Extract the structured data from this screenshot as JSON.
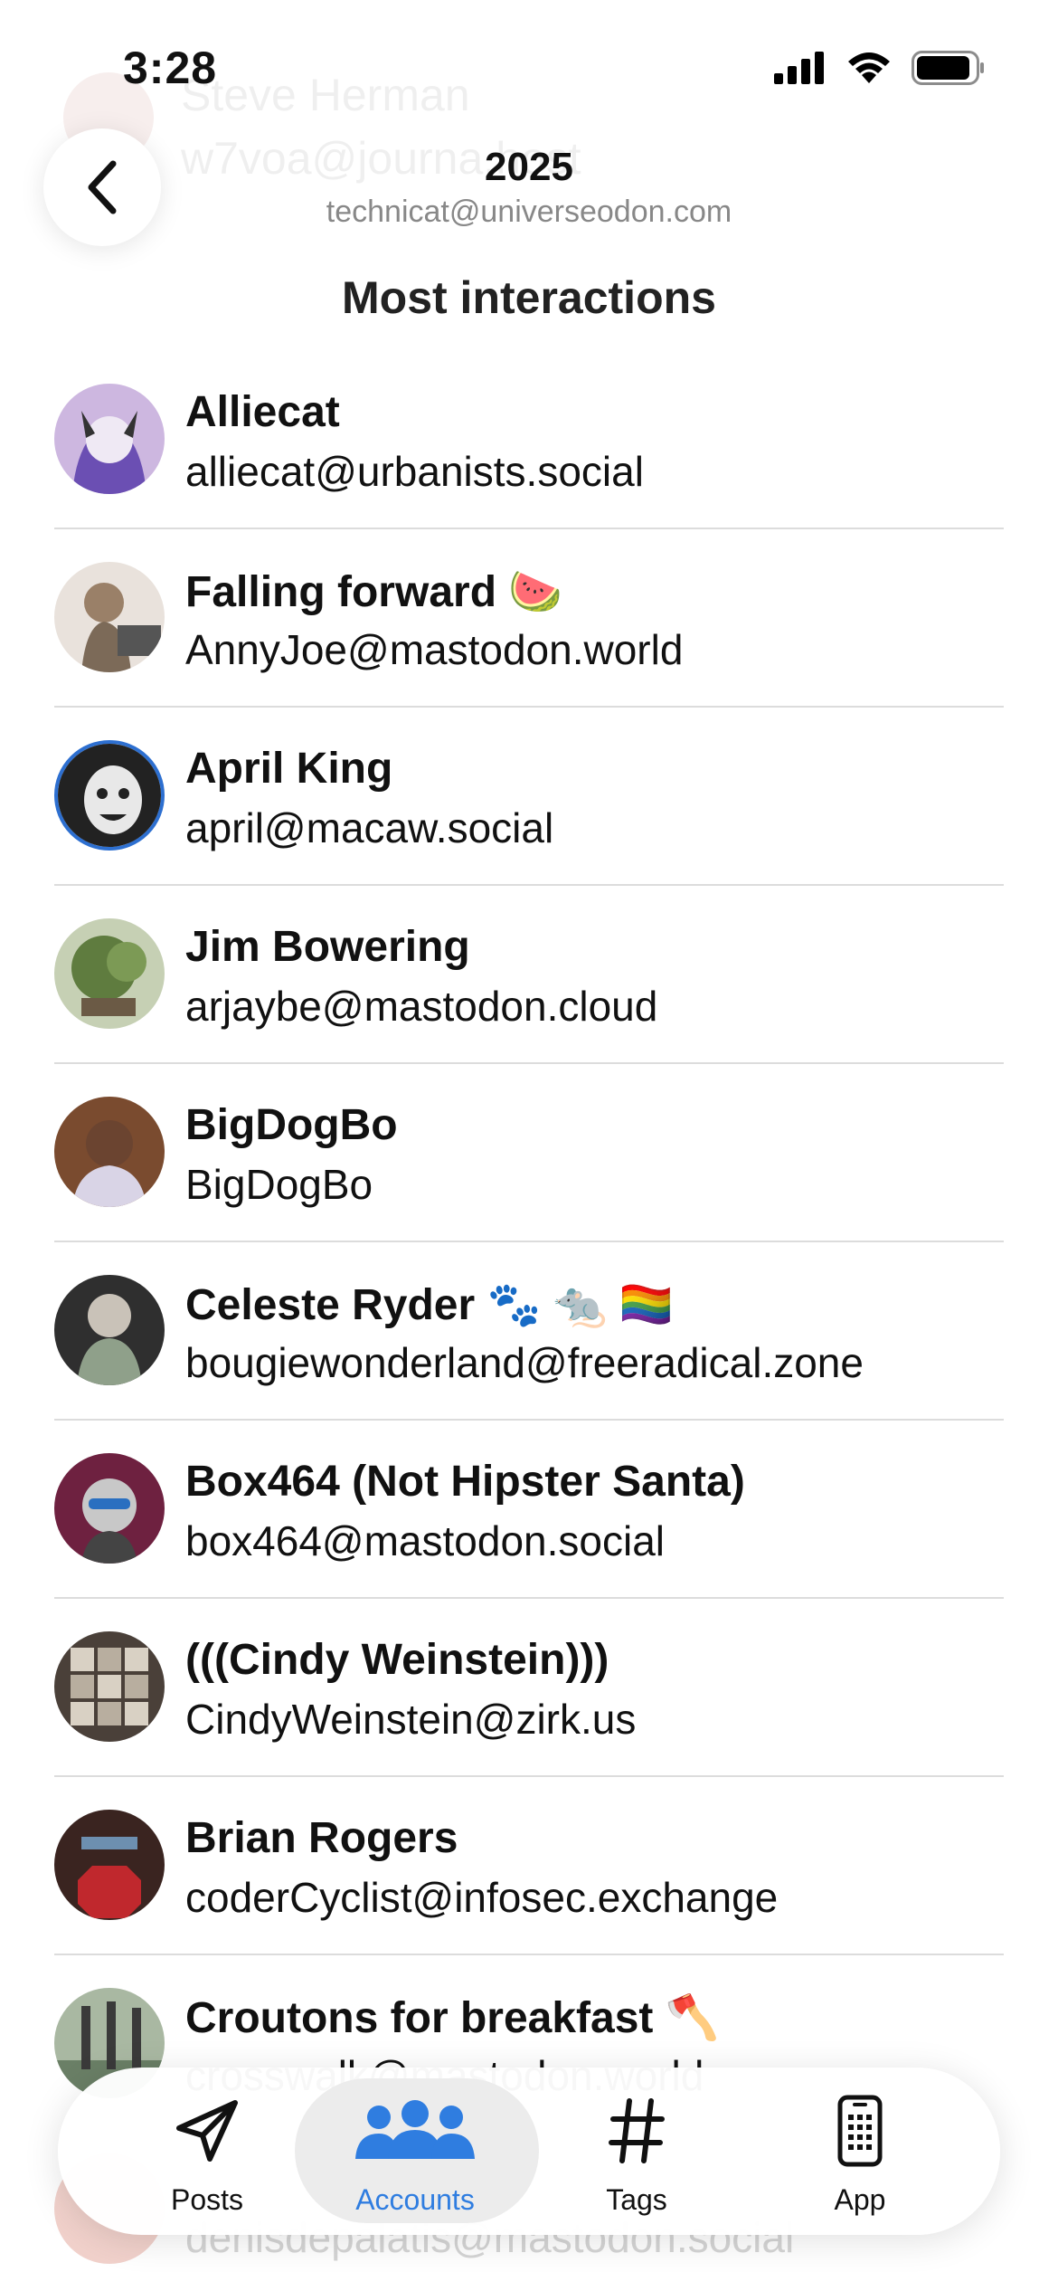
{
  "status_bar": {
    "time": "3:28"
  },
  "header": {
    "title": "2025",
    "subtitle": "technicat@universeodon.com",
    "back_icon": "chevron-left-icon"
  },
  "section_title": "Most interactions",
  "accounts": [
    {
      "name": "Alliecat",
      "emoji": "",
      "handle": "alliecat@urbanists.social",
      "avatar_color": "#6b4fb3"
    },
    {
      "name": "Falling forward",
      "emoji": "🍉",
      "handle": "AnnyJoe@mastodon.world",
      "avatar_color": "#b9a995"
    },
    {
      "name": "April King",
      "emoji": "",
      "handle": "april@macaw.social",
      "avatar_color": "#2d6fd0"
    },
    {
      "name": "Jim Bowering",
      "emoji": "",
      "handle": "arjaybe@mastodon.cloud",
      "avatar_color": "#5f7c3f"
    },
    {
      "name": "BigDogBo",
      "emoji": "",
      "handle": "BigDogBo",
      "avatar_color": "#7a4b2f"
    },
    {
      "name": "Celeste Ryder",
      "emoji": "🐾 🐀 🏳️‍🌈",
      "handle": "bougiewonderland@freeradical.zone",
      "avatar_color": "#2f2f2f"
    },
    {
      "name": "Box464 (Not Hipster Santa)",
      "emoji": "",
      "handle": "box464@mastodon.social",
      "avatar_color": "#6e2140"
    },
    {
      "name": "(((Cindy Weinstein)))",
      "emoji": "",
      "handle": "CindyWeinstein@zirk.us",
      "avatar_color": "#4a4039"
    },
    {
      "name": "Brian Rogers",
      "emoji": "",
      "handle": "coderCyclist@infosec.exchange",
      "avatar_color": "#3a2420"
    },
    {
      "name": "Croutons for breakfast",
      "emoji": "🪓",
      "handle": "crosswalk@mastodon.world",
      "avatar_color": "#6a7f66"
    }
  ],
  "ghost": {
    "top_name": "Steve Herman",
    "top_handle": "w7voa@journa.host",
    "bottom_handle": "denisdepalatis@mastodon.social"
  },
  "tabs": [
    {
      "label": "Posts",
      "icon": "paper-plane-icon",
      "active": false
    },
    {
      "label": "Accounts",
      "icon": "people-icon",
      "active": true
    },
    {
      "label": "Tags",
      "icon": "hashtag-icon",
      "active": false
    },
    {
      "label": "App",
      "icon": "phone-icon",
      "active": false
    }
  ],
  "colors": {
    "accent": "#2f7de0",
    "divider": "#dcdcdc"
  }
}
